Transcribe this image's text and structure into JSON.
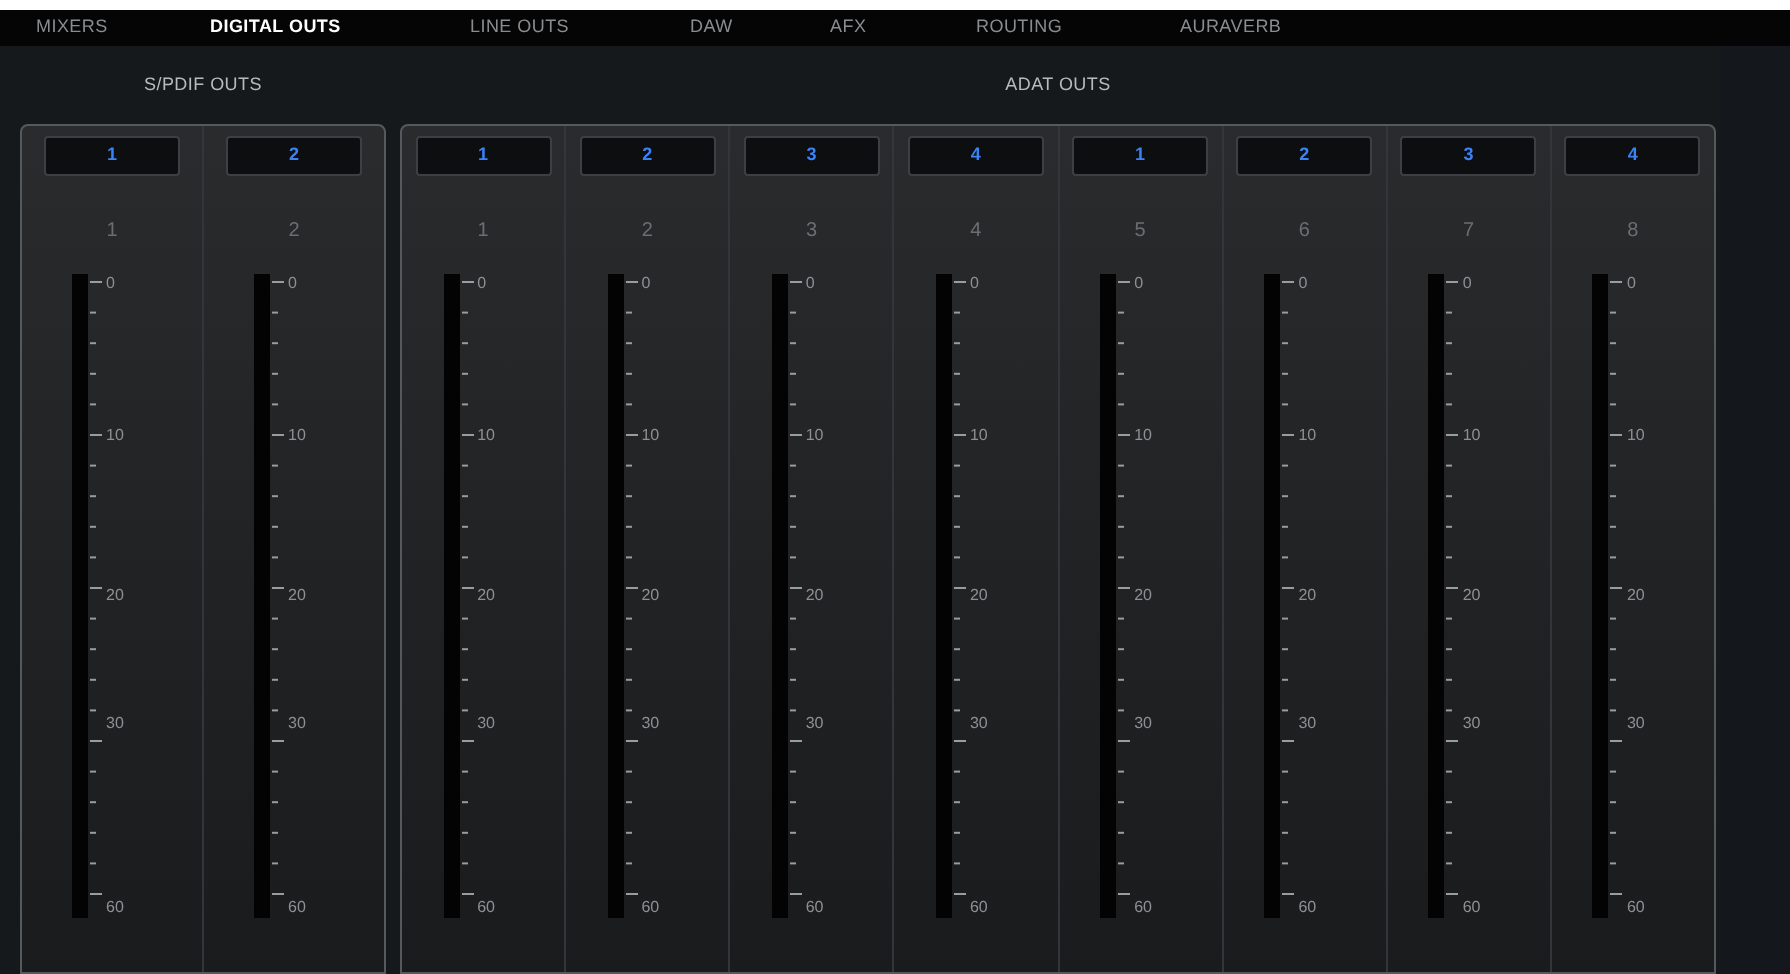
{
  "tabs": [
    {
      "label": "MIXERS",
      "selected": false
    },
    {
      "label": "DIGITAL OUTS",
      "selected": true
    },
    {
      "label": "LINE OUTS",
      "selected": false
    },
    {
      "label": "DAW",
      "selected": false
    },
    {
      "label": "AFX",
      "selected": false
    },
    {
      "label": "ROUTING",
      "selected": false
    },
    {
      "label": "AURAVERB",
      "selected": false
    }
  ],
  "groups": [
    {
      "title": "S/PDIF OUTS",
      "channels": [
        {
          "source": "1",
          "label": "1",
          "scale": [
            "0",
            "10",
            "20",
            "30",
            "60"
          ]
        },
        {
          "source": "2",
          "label": "2",
          "scale": [
            "0",
            "10",
            "20",
            "30",
            "60"
          ]
        }
      ]
    },
    {
      "title": "ADAT OUTS",
      "channels": [
        {
          "source": "1",
          "label": "1",
          "scale": [
            "0",
            "10",
            "20",
            "30",
            "60"
          ]
        },
        {
          "source": "2",
          "label": "2",
          "scale": [
            "0",
            "10",
            "20",
            "30",
            "60"
          ]
        },
        {
          "source": "3",
          "label": "3",
          "scale": [
            "0",
            "10",
            "20",
            "30",
            "60"
          ]
        },
        {
          "source": "4",
          "label": "4",
          "scale": [
            "0",
            "10",
            "20",
            "30",
            "60"
          ]
        },
        {
          "source": "1",
          "label": "5",
          "scale": [
            "0",
            "10",
            "20",
            "30",
            "60"
          ]
        },
        {
          "source": "2",
          "label": "6",
          "scale": [
            "0",
            "10",
            "20",
            "30",
            "60"
          ]
        },
        {
          "source": "3",
          "label": "7",
          "scale": [
            "0",
            "10",
            "20",
            "30",
            "60"
          ]
        },
        {
          "source": "4",
          "label": "8",
          "scale": [
            "0",
            "10",
            "20",
            "30",
            "60"
          ]
        }
      ]
    }
  ]
}
